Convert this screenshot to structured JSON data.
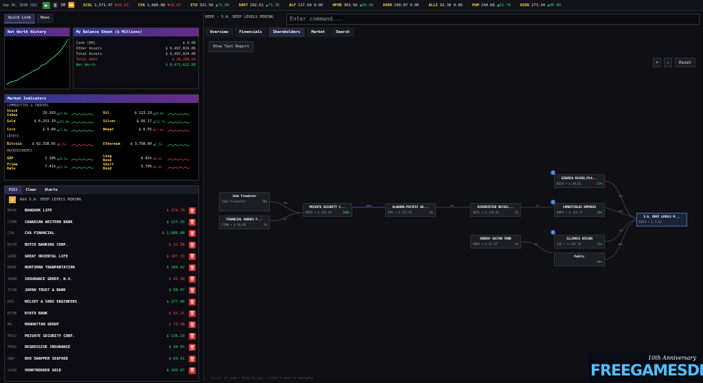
{
  "top": {
    "date": "Sep 30, 2038 (Q3)",
    "speed": "30",
    "tickers": [
      {
        "sym": "ECOL",
        "price": "1,571.47",
        "chg": "▼18.63",
        "dir": "dn"
      },
      {
        "sym": "CVA",
        "price": "1,686.88",
        "chg": "▼16.87",
        "dir": "dn"
      },
      {
        "sym": "ETO",
        "price": "322.50",
        "chg": "▲72.88",
        "dir": "up"
      },
      {
        "sym": "SHOT",
        "price": "292.61",
        "chg": "▲75.36",
        "dir": "up"
      },
      {
        "sym": "ALF",
        "price": "117.60",
        "chg": "0.06",
        "dir": ""
      },
      {
        "sym": "NFUB",
        "price": "303.50",
        "chg": "▲69.96",
        "dir": "up"
      },
      {
        "sym": "VOOR",
        "price": "100.07",
        "chg": "0.06",
        "dir": ""
      },
      {
        "sym": "ALLI",
        "price": "92.36",
        "chg": "0.06",
        "dir": ""
      },
      {
        "sym": "PUM",
        "price": "244.66",
        "chg": "▲61.78",
        "dir": "up"
      },
      {
        "sym": "DZOU",
        "price": "273.34",
        "chg": "▲40.80",
        "dir": "up"
      }
    ]
  },
  "left": {
    "tabs": [
      "Quick Look",
      "News"
    ],
    "networth_title": "Net Worth History",
    "balance": {
      "title": "My Balance Sheet ($ Millions)",
      "rows": [
        {
          "label": "Cash [00]",
          "value": "$ 0.00",
          "color": "#ccc"
        },
        {
          "label": "Other Assets",
          "value": "$ 6,497,824.06",
          "color": "#ccc"
        },
        {
          "label": "Total Assets",
          "value": "$ 6,497,824.06",
          "color": "#ccc"
        },
        {
          "label": "Total Debt",
          "value": "$ 26,208.54",
          "color": "#ff4d4d"
        },
        {
          "label": "Net Worth",
          "value": "$ 6,471,612.89",
          "color": "#37d67a"
        }
      ]
    },
    "indicators": {
      "title": "Market Indicators",
      "sec1": "COMMODITIES & INDEXES",
      "sec2": "CRYPTO",
      "sec3": "MACROECONOMIC",
      "left1": [
        {
          "name": "Stock Index",
          "value": "29,393",
          "chg": "▲12.8%",
          "dir": "up"
        },
        {
          "name": "Gold",
          "value": "$ 6,253.19",
          "chg": "▲265.0%",
          "dir": "up"
        },
        {
          "name": "Corn",
          "value": "$ 5.84",
          "chg": "▲17.8%",
          "dir": "up"
        }
      ],
      "right1": [
        {
          "name": "Oil",
          "value": "$ 123.29",
          "chg": "▲43.8%",
          "dir": "up"
        },
        {
          "name": "Silver",
          "value": "$ 66.17",
          "chg": "▲111.7%",
          "dir": "up"
        },
        {
          "name": "Wheat",
          "value": "$ 6.55",
          "chg": "▼17.6%",
          "dir": "dn"
        }
      ],
      "crypto": [
        {
          "name": "Bitcoin",
          "value": "$ 92,338.05",
          "chg": "▼8.7%",
          "dir": "dn"
        },
        {
          "name": "Ethereum",
          "value": "$ 3,798.00",
          "chg": "▲1.7%",
          "dir": "up"
        }
      ],
      "macro": [
        {
          "name": "GDP",
          "value": "2.10%",
          "chg": "▲10.5%",
          "dir": "up"
        },
        {
          "name": "Long Bond",
          "value": "6.81%",
          "chg": "▼9.4%",
          "dir": "dn"
        },
        {
          "name": "Prime Rate",
          "value": "7.41%",
          "chg": "▲12.3%",
          "dir": "up"
        },
        {
          "name": "Short Bond",
          "value": "5.70%",
          "chg": "▼4.3%",
          "dir": "dn"
        }
      ]
    },
    "watch": {
      "buttons": [
        "Fill",
        "Clear",
        "Alerts"
      ],
      "add_label": "Add S.A. DEEP LEVELS MINING",
      "rows": [
        {
          "sym": "BKOK",
          "name": "BANGKOK LIFE",
          "price": "$ 274.73",
          "dir": "dn"
        },
        {
          "sym": "CIMB",
          "name": "CANADIAN WESTERN BANK",
          "price": "$ 127.33",
          "dir": "up"
        },
        {
          "sym": "CVA",
          "name": "CVA FINANCIAL",
          "price": "$ 1,686.88",
          "dir": "up"
        },
        {
          "sym": "DUTB",
          "name": "DUTCH BANKING CORP.",
          "price": "$ 33.88",
          "dir": "dn"
        },
        {
          "sym": "GORI",
          "name": "GREAT ORIENTAL LIFE",
          "price": "$ 107.53",
          "dir": "dn"
        },
        {
          "sym": "HUNT",
          "name": "HUNTSMAN TRANPORTATION",
          "price": "$ 189.42",
          "dir": "up"
        },
        {
          "sym": "INGN",
          "name": "INSURANCE GROEP, N.V.",
          "price": "$ 41.38",
          "dir": "dn"
        },
        {
          "sym": "ITUB",
          "name": "JAPAN TRUST & BANK",
          "price": "$ 58.47",
          "dir": "up"
        },
        {
          "sym": "KES",
          "name": "KELSEY & SONS ENGINEERS",
          "price": "$ 277.06",
          "dir": "up"
        },
        {
          "sym": "KYOB",
          "name": "KYOTO BANK",
          "price": "$ 55.21",
          "dir": "dn"
        },
        {
          "sym": "MG",
          "name": "MANHATTAN GROUP",
          "price": "$ 73.38",
          "dir": "dn"
        },
        {
          "sym": "PRIV",
          "name": "PRIVATE SECURITY CORP.",
          "price": "$ 136.29",
          "dir": "up"
        },
        {
          "sym": "PROG",
          "name": "REGRESSIVE INSURANCE",
          "price": "$ 38.65",
          "dir": "up"
        },
        {
          "sym": "SNP",
          "name": "RED SNAPPER SEAFOOD",
          "price": "$ 69.41",
          "dir": "up"
        },
        {
          "sym": "VOOR",
          "name": "VOORTREKKER GOLD",
          "price": "$ 100.07",
          "dir": "up"
        }
      ]
    }
  },
  "main": {
    "title": "DEEP - S.A. DEEP LEVELS MINING",
    "cmd_placeholder": "Enter command...",
    "tabs": [
      "Overview",
      "Financials",
      "Shareholders",
      "Market",
      "Search"
    ],
    "report": "Show Text Report",
    "zoom_in": "+",
    "zoom_out": "−",
    "reset": "Reset",
    "hint": "Scroll to zoom • Drag to pan • Click a node to navigate",
    "nodes": [
      {
        "title": "John Freedster",
        "sub": "John Freedster",
        "pct": "78%"
      },
      {
        "title": "FINANCIAL SHARES F...",
        "sub": "FINN • $ 94.85",
        "pct": "2%"
      },
      {
        "title": "PRIVATE SECURITY C...",
        "sub": "PRIV • $ 136.29",
        "pct": "100%"
      },
      {
        "title": "ALABAMA-PACIFIC GR...",
        "sub": "SPG • $ 227.91",
        "pct": "6%"
      },
      {
        "title": "DIVERSIFIED RETAIL...",
        "sub": "RETL • $ 118.63",
        "pct": "5%"
      },
      {
        "title": "ENERGY SECTOR FUND",
        "sub": "ENRG • $ 51.47",
        "pct": "2%"
      },
      {
        "title": "SIBERIA NICKEL/PLA...",
        "sub": "NICK • $ 38.61",
        "pct": "11%"
      },
      {
        "title": "COMESTIBLES EMPORIA",
        "sub": "EMPO • $ 113.37",
        "pct": "10%"
      },
      {
        "title": "ILLINOIS EDISON",
        "sub": "ILE • $ 245.78",
        "pct": "15%"
      },
      {
        "title": "Public",
        "sub": "",
        "pct": "64%"
      },
      {
        "title": "S.A. DEEP LEVELS M...",
        "sub": "DEEP • $ 7.82",
        "pct": ""
      }
    ],
    "edges": [
      "78%",
      "2%",
      "100%",
      "6%",
      "5%",
      "2%",
      "11%",
      "10%",
      "15%",
      "64%"
    ],
    "badges": [
      "3",
      "3",
      "4"
    ]
  },
  "watermark": {
    "anniv": "10th Anniversary",
    "brand": "FREEGAMESDL"
  }
}
